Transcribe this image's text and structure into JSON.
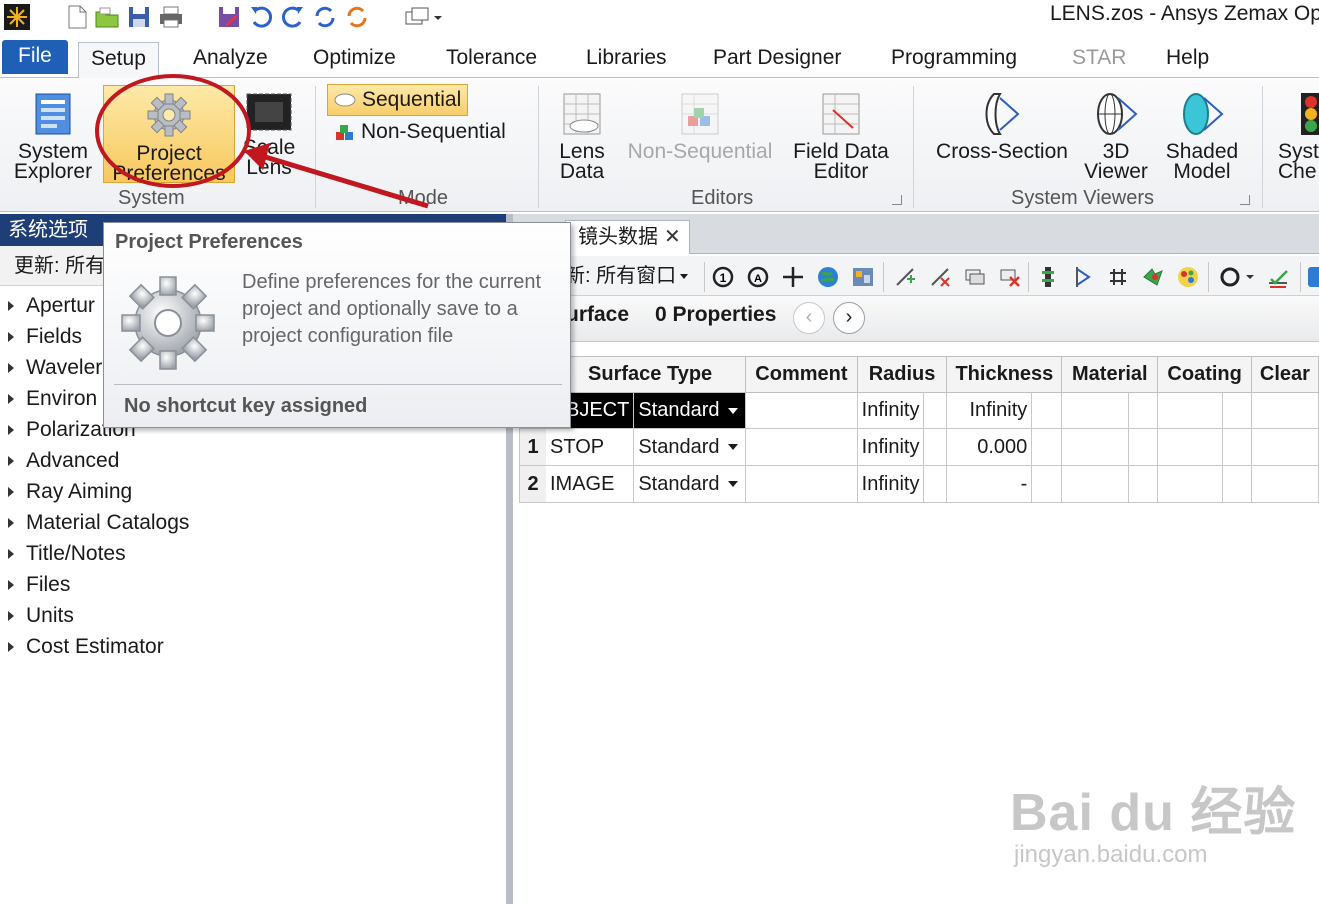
{
  "app": {
    "title": "LENS.zos - Ansys Zemax Op"
  },
  "ribbon_tabs": [
    {
      "label": "File"
    },
    {
      "label": "Setup"
    },
    {
      "label": "Analyze"
    },
    {
      "label": "Optimize"
    },
    {
      "label": "Tolerance"
    },
    {
      "label": "Libraries"
    },
    {
      "label": "Part Designer"
    },
    {
      "label": "Programming"
    },
    {
      "label": "STAR"
    },
    {
      "label": "Help"
    }
  ],
  "active_tab": "Setup",
  "ribbon": {
    "system": {
      "group_label": "System",
      "system_explorer": [
        "System",
        "Explorer"
      ],
      "project_preferences": [
        "Project",
        "Preferences"
      ],
      "scale_lens": [
        "Scale",
        "Lens"
      ]
    },
    "mode": {
      "group_label": "Mode",
      "sequential": "Sequential",
      "non_sequential": "Non-Sequential",
      "selected": "Sequential"
    },
    "editors": {
      "group_label": "Editors",
      "lens_data": [
        "Lens",
        "Data"
      ],
      "non_sequential": "Non-Sequential",
      "field_data_editor": [
        "Field Data",
        "Editor"
      ]
    },
    "system_viewers": {
      "group_label": "System Viewers",
      "cross_section": "Cross-Section",
      "viewer_3d": [
        "3D",
        "Viewer"
      ],
      "shaded_model": [
        "Shaded",
        "Model"
      ]
    },
    "clipped": [
      "Syst",
      "Che"
    ]
  },
  "left_panel": {
    "title": "系统选项",
    "update": "更新: 所有",
    "items": [
      "Apertur",
      "Fields",
      "Waveler",
      "Environ",
      "Polarization",
      "Advanced",
      "Ray Aiming",
      "Material Catalogs",
      "Title/Notes",
      "Files",
      "Units",
      "Cost Estimator"
    ]
  },
  "editor": {
    "tab_label": "镜头数据",
    "tab_close": "✕",
    "update": "新: 所有窗口",
    "surface_label": "urface",
    "properties_label": "0 Properties",
    "prev_icon": "chevron-left-icon",
    "next_icon": "chevron-right-icon",
    "columns": [
      "Surface Type",
      "Comment",
      "Radius",
      "Thickness",
      "Material",
      "Coating",
      "Clear"
    ],
    "rows": [
      {
        "num": "",
        "name": "BJECT",
        "type": "Standard",
        "comment": "",
        "radius": "Infinity",
        "thickness": "Infinity"
      },
      {
        "num": "1",
        "name": "STOP",
        "type": "Standard",
        "comment": "",
        "radius": "Infinity",
        "thickness": "0.000"
      },
      {
        "num": "2",
        "name": "IMAGE",
        "type": "Standard",
        "comment": "",
        "radius": "Infinity",
        "thickness": "-"
      }
    ]
  },
  "tooltip": {
    "title": "Project Preferences",
    "description": "Define preferences for the current project and optionally save to a project configuration file",
    "shortcut": "No shortcut key assigned",
    "icon": "gear-icon"
  },
  "watermark": {
    "logo": "Bai du 经验",
    "url": "jingyan.baidu.com"
  },
  "colors": {
    "file_tab": "#1f5fb5",
    "panel_header": "#1e3e78",
    "highlight": "#f8c85d",
    "annotation": "#c0181e"
  }
}
